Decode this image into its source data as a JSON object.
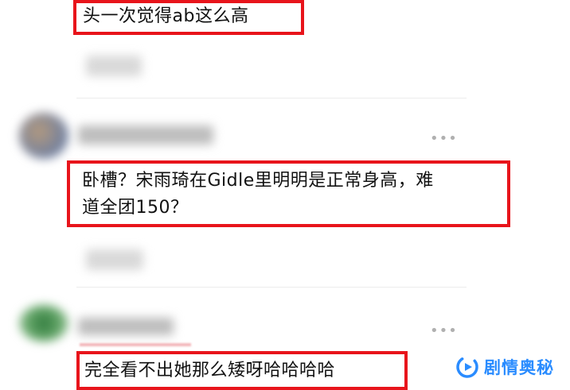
{
  "comments": [
    {
      "text_lines": [
        "头一次觉得ab这么高"
      ]
    },
    {
      "text_lines": [
        "卧槽？宋雨琦在Gidle里明明是正常身高，难",
        "道全团150？"
      ]
    },
    {
      "text_lines": [
        "完全看不出她那么矮呀哈哈哈哈"
      ]
    }
  ],
  "more_label": "•••",
  "watermark": {
    "text": "剧情奥秘",
    "icon": "play-swirl-icon",
    "color": "#2a8cff"
  },
  "highlight_color": "#e8141b"
}
